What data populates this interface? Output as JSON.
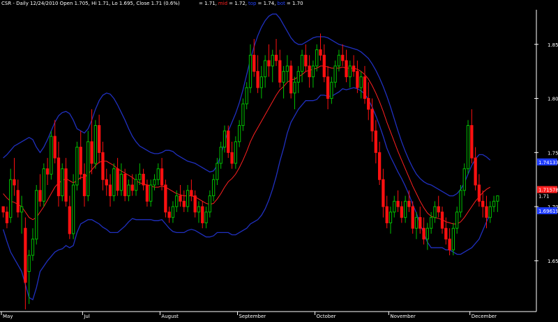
{
  "header": {
    "title": "CSR - Daily 12/24/2010 Open 1.705, Hi 1.71, Lo 1.695, Close 1.71 (0.6%)",
    "indicator_items": [
      {
        "text": "= 1.71,",
        "color": "#ffffff"
      },
      {
        "text": "mid",
        "color": "#ff2020"
      },
      {
        "text": "= 1.72,",
        "color": "#ffffff"
      },
      {
        "text": "top",
        "color": "#2040ff"
      },
      {
        "text": "= 1.74,",
        "color": "#ffffff"
      },
      {
        "text": "bot",
        "color": "#2040ff"
      },
      {
        "text": "= 1.70",
        "color": "#ffffff"
      }
    ]
  },
  "chart_data": {
    "type": "candlestick",
    "symbol": "CSR",
    "ylim": [
      1.603,
      1.882
    ],
    "y_ticks": [
      "1.850",
      "1.800",
      "1.750",
      "1.700",
      "1.650"
    ],
    "x_labels": [
      {
        "label": "May",
        "index": 0
      },
      {
        "label": "Jul",
        "index": 22
      },
      {
        "label": "August",
        "index": 43
      },
      {
        "label": "September",
        "index": 64
      },
      {
        "label": "October",
        "index": 85
      },
      {
        "label": "November",
        "index": 105
      },
      {
        "label": "December",
        "index": 127
      }
    ],
    "last_labels": [
      {
        "text": "1.74133",
        "value": 1.74133,
        "bg": "#1e3cff",
        "fg": "#ffffff"
      },
      {
        "text": "1.71578",
        "value": 1.71578,
        "bg": "#ff2020",
        "fg": "#ffffff"
      },
      {
        "text": "1.71",
        "value": 1.71,
        "bg": "",
        "fg": "#ffffff"
      },
      {
        "text": "1.69619",
        "value": 1.69619,
        "bg": "#1e3cff",
        "fg": "#ffffff"
      }
    ],
    "colors": {
      "up": "#00c000",
      "down": "#ff1010",
      "mid": "#ff2020",
      "band": "#2030c0",
      "grid": "#ffffff"
    },
    "ohlc": [
      [
        1.7,
        1.7,
        1.69,
        1.695
      ],
      [
        1.695,
        1.7,
        1.68,
        1.685
      ],
      [
        1.69,
        1.735,
        1.685,
        1.725
      ],
      [
        1.725,
        1.745,
        1.71,
        1.72
      ],
      [
        1.715,
        1.725,
        1.69,
        1.695
      ],
      [
        1.695,
        1.71,
        1.675,
        1.7
      ],
      [
        1.68,
        1.69,
        1.605,
        1.63
      ],
      [
        1.64,
        1.66,
        1.61,
        1.655
      ],
      [
        1.655,
        1.68,
        1.65,
        1.67
      ],
      [
        1.67,
        1.72,
        1.665,
        1.715
      ],
      [
        1.715,
        1.73,
        1.7,
        1.705
      ],
      [
        1.705,
        1.74,
        1.7,
        1.735
      ],
      [
        1.735,
        1.745,
        1.72,
        1.73
      ],
      [
        1.73,
        1.77,
        1.725,
        1.765
      ],
      [
        1.765,
        1.78,
        1.74,
        1.745
      ],
      [
        1.745,
        1.76,
        1.7,
        1.71
      ],
      [
        1.71,
        1.74,
        1.705,
        1.735
      ],
      [
        1.735,
        1.745,
        1.7,
        1.705
      ],
      [
        1.7,
        1.71,
        1.67,
        1.675
      ],
      [
        1.675,
        1.73,
        1.67,
        1.72
      ],
      [
        1.72,
        1.76,
        1.715,
        1.755
      ],
      [
        1.755,
        1.77,
        1.725,
        1.73
      ],
      [
        1.73,
        1.74,
        1.7,
        1.71
      ],
      [
        1.71,
        1.77,
        1.705,
        1.76
      ],
      [
        1.76,
        1.79,
        1.73,
        1.74
      ],
      [
        1.74,
        1.78,
        1.735,
        1.775
      ],
      [
        1.775,
        1.785,
        1.74,
        1.75
      ],
      [
        1.75,
        1.76,
        1.715,
        1.725
      ],
      [
        1.725,
        1.735,
        1.71,
        1.72
      ],
      [
        1.72,
        1.73,
        1.7,
        1.71
      ],
      [
        1.71,
        1.74,
        1.705,
        1.735
      ],
      [
        1.735,
        1.745,
        1.71,
        1.715
      ],
      [
        1.715,
        1.74,
        1.71,
        1.73
      ],
      [
        1.73,
        1.735,
        1.705,
        1.71
      ],
      [
        1.71,
        1.725,
        1.705,
        1.72
      ],
      [
        1.72,
        1.73,
        1.71,
        1.715
      ],
      [
        1.715,
        1.73,
        1.71,
        1.725
      ],
      [
        1.725,
        1.74,
        1.72,
        1.73
      ],
      [
        1.73,
        1.735,
        1.715,
        1.72
      ],
      [
        1.72,
        1.725,
        1.7,
        1.705
      ],
      [
        1.705,
        1.725,
        1.7,
        1.72
      ],
      [
        1.72,
        1.73,
        1.715,
        1.725
      ],
      [
        1.725,
        1.74,
        1.72,
        1.735
      ],
      [
        1.735,
        1.745,
        1.715,
        1.72
      ],
      [
        1.72,
        1.725,
        1.69,
        1.695
      ],
      [
        1.695,
        1.7,
        1.685,
        1.69
      ],
      [
        1.69,
        1.705,
        1.685,
        1.7
      ],
      [
        1.7,
        1.715,
        1.695,
        1.71
      ],
      [
        1.71,
        1.72,
        1.7,
        1.705
      ],
      [
        1.705,
        1.715,
        1.695,
        1.7
      ],
      [
        1.7,
        1.72,
        1.695,
        1.715
      ],
      [
        1.715,
        1.725,
        1.705,
        1.71
      ],
      [
        1.71,
        1.715,
        1.69,
        1.695
      ],
      [
        1.695,
        1.705,
        1.685,
        1.7
      ],
      [
        1.7,
        1.705,
        1.68,
        1.685
      ],
      [
        1.685,
        1.7,
        1.68,
        1.695
      ],
      [
        1.695,
        1.715,
        1.69,
        1.71
      ],
      [
        1.71,
        1.73,
        1.705,
        1.725
      ],
      [
        1.725,
        1.745,
        1.72,
        1.74
      ],
      [
        1.74,
        1.76,
        1.735,
        1.755
      ],
      [
        1.755,
        1.775,
        1.75,
        1.77
      ],
      [
        1.77,
        1.775,
        1.745,
        1.75
      ],
      [
        1.75,
        1.76,
        1.735,
        1.74
      ],
      [
        1.74,
        1.765,
        1.735,
        1.76
      ],
      [
        1.76,
        1.78,
        1.755,
        1.775
      ],
      [
        1.775,
        1.8,
        1.77,
        1.795
      ],
      [
        1.795,
        1.815,
        1.79,
        1.81
      ],
      [
        1.81,
        1.85,
        1.805,
        1.84
      ],
      [
        1.84,
        1.855,
        1.82,
        1.825
      ],
      [
        1.825,
        1.84,
        1.805,
        1.81
      ],
      [
        1.81,
        1.83,
        1.8,
        1.82
      ],
      [
        1.82,
        1.84,
        1.81,
        1.835
      ],
      [
        1.835,
        1.85,
        1.82,
        1.83
      ],
      [
        1.83,
        1.845,
        1.815,
        1.84
      ],
      [
        1.84,
        1.855,
        1.83,
        1.835
      ],
      [
        1.835,
        1.845,
        1.81,
        1.815
      ],
      [
        1.815,
        1.83,
        1.8,
        1.825
      ],
      [
        1.825,
        1.84,
        1.815,
        1.83
      ],
      [
        1.83,
        1.835,
        1.8,
        1.805
      ],
      [
        1.805,
        1.82,
        1.79,
        1.815
      ],
      [
        1.815,
        1.83,
        1.805,
        1.825
      ],
      [
        1.825,
        1.845,
        1.815,
        1.84
      ],
      [
        1.84,
        1.85,
        1.825,
        1.83
      ],
      [
        1.83,
        1.84,
        1.81,
        1.82
      ],
      [
        1.82,
        1.835,
        1.81,
        1.83
      ],
      [
        1.83,
        1.85,
        1.825,
        1.845
      ],
      [
        1.845,
        1.86,
        1.835,
        1.84
      ],
      [
        1.84,
        1.85,
        1.815,
        1.82
      ],
      [
        1.82,
        1.83,
        1.79,
        1.8
      ],
      [
        1.8,
        1.82,
        1.795,
        1.815
      ],
      [
        1.815,
        1.835,
        1.81,
        1.83
      ],
      [
        1.83,
        1.845,
        1.825,
        1.84
      ],
      [
        1.84,
        1.85,
        1.83,
        1.835
      ],
      [
        1.835,
        1.845,
        1.815,
        1.82
      ],
      [
        1.82,
        1.835,
        1.81,
        1.83
      ],
      [
        1.83,
        1.84,
        1.82,
        1.825
      ],
      [
        1.825,
        1.835,
        1.805,
        1.81
      ],
      [
        1.81,
        1.825,
        1.8,
        1.82
      ],
      [
        1.82,
        1.83,
        1.795,
        1.8
      ],
      [
        1.8,
        1.815,
        1.78,
        1.79
      ],
      [
        1.79,
        1.8,
        1.76,
        1.77
      ],
      [
        1.77,
        1.78,
        1.74,
        1.75
      ],
      [
        1.75,
        1.76,
        1.72,
        1.725
      ],
      [
        1.725,
        1.735,
        1.69,
        1.7
      ],
      [
        1.7,
        1.71,
        1.68,
        1.685
      ],
      [
        1.685,
        1.7,
        1.675,
        1.695
      ],
      [
        1.695,
        1.71,
        1.69,
        1.705
      ],
      [
        1.705,
        1.715,
        1.695,
        1.7
      ],
      [
        1.7,
        1.705,
        1.685,
        1.69
      ],
      [
        1.69,
        1.71,
        1.685,
        1.705
      ],
      [
        1.705,
        1.715,
        1.695,
        1.7
      ],
      [
        1.7,
        1.705,
        1.675,
        1.68
      ],
      [
        1.68,
        1.695,
        1.67,
        1.69
      ],
      [
        1.69,
        1.7,
        1.675,
        1.68
      ],
      [
        1.68,
        1.69,
        1.665,
        1.67
      ],
      [
        1.67,
        1.685,
        1.66,
        1.68
      ],
      [
        1.68,
        1.695,
        1.675,
        1.69
      ],
      [
        1.69,
        1.705,
        1.685,
        1.7
      ],
      [
        1.7,
        1.71,
        1.69,
        1.695
      ],
      [
        1.695,
        1.7,
        1.675,
        1.68
      ],
      [
        1.68,
        1.69,
        1.665,
        1.67
      ],
      [
        1.67,
        1.68,
        1.655,
        1.66
      ],
      [
        1.66,
        1.685,
        1.655,
        1.68
      ],
      [
        1.68,
        1.7,
        1.675,
        1.695
      ],
      [
        1.695,
        1.72,
        1.69,
        1.715
      ],
      [
        1.715,
        1.74,
        1.71,
        1.735
      ],
      [
        1.735,
        1.78,
        1.73,
        1.775
      ],
      [
        1.775,
        1.79,
        1.74,
        1.745
      ],
      [
        1.745,
        1.755,
        1.715,
        1.72
      ],
      [
        1.72,
        1.73,
        1.7,
        1.705
      ],
      [
        1.705,
        1.715,
        1.69,
        1.7
      ],
      [
        1.7,
        1.71,
        1.68,
        1.69
      ],
      [
        1.69,
        1.705,
        1.685,
        1.7
      ],
      [
        1.7,
        1.71,
        1.695,
        1.705
      ],
      [
        1.705,
        1.71,
        1.695,
        1.71
      ]
    ],
    "mid": [
      1.712,
      1.708,
      1.705,
      1.704,
      1.702,
      1.7,
      1.695,
      1.69,
      1.688,
      1.69,
      1.695,
      1.7,
      1.706,
      1.712,
      1.718,
      1.722,
      1.724,
      1.726,
      1.724,
      1.722,
      1.724,
      1.727,
      1.727,
      1.73,
      1.734,
      1.738,
      1.741,
      1.742,
      1.742,
      1.74,
      1.738,
      1.735,
      1.733,
      1.731,
      1.729,
      1.727,
      1.724,
      1.722,
      1.721,
      1.72,
      1.719,
      1.718,
      1.718,
      1.719,
      1.718,
      1.716,
      1.714,
      1.712,
      1.711,
      1.71,
      1.71,
      1.71,
      1.709,
      1.707,
      1.705,
      1.703,
      1.702,
      1.703,
      1.707,
      1.712,
      1.718,
      1.723,
      1.726,
      1.73,
      1.736,
      1.743,
      1.751,
      1.76,
      1.767,
      1.773,
      1.779,
      1.785,
      1.791,
      1.797,
      1.803,
      1.808,
      1.811,
      1.815,
      1.817,
      1.818,
      1.82,
      1.822,
      1.825,
      1.826,
      1.827,
      1.828,
      1.83,
      1.83,
      1.829,
      1.828,
      1.828,
      1.828,
      1.829,
      1.828,
      1.828,
      1.828,
      1.827,
      1.825,
      1.822,
      1.818,
      1.812,
      1.805,
      1.797,
      1.788,
      1.778,
      1.769,
      1.76,
      1.751,
      1.743,
      1.735,
      1.727,
      1.719,
      1.712,
      1.705,
      1.699,
      1.694,
      1.691,
      1.69,
      1.689,
      1.688,
      1.686,
      1.685,
      1.684,
      1.684,
      1.686,
      1.69,
      1.695,
      1.7,
      1.705,
      1.709,
      1.713,
      1.716,
      1.718
    ],
    "top": [
      1.745,
      1.748,
      1.752,
      1.756,
      1.758,
      1.76,
      1.762,
      1.764,
      1.762,
      1.755,
      1.75,
      1.755,
      1.762,
      1.77,
      1.778,
      1.784,
      1.787,
      1.788,
      1.786,
      1.78,
      1.772,
      1.77,
      1.768,
      1.772,
      1.78,
      1.79,
      1.798,
      1.803,
      1.805,
      1.804,
      1.8,
      1.794,
      1.787,
      1.78,
      1.772,
      1.765,
      1.76,
      1.756,
      1.754,
      1.752,
      1.75,
      1.749,
      1.749,
      1.75,
      1.752,
      1.752,
      1.751,
      1.748,
      1.746,
      1.744,
      1.742,
      1.741,
      1.74,
      1.738,
      1.736,
      1.734,
      1.732,
      1.733,
      1.738,
      1.748,
      1.76,
      1.77,
      1.778,
      1.786,
      1.796,
      1.808,
      1.822,
      1.836,
      1.848,
      1.858,
      1.866,
      1.872,
      1.876,
      1.878,
      1.878,
      1.874,
      1.868,
      1.862,
      1.856,
      1.852,
      1.85,
      1.85,
      1.852,
      1.854,
      1.856,
      1.857,
      1.857,
      1.857,
      1.856,
      1.854,
      1.852,
      1.85,
      1.849,
      1.848,
      1.847,
      1.846,
      1.845,
      1.843,
      1.84,
      1.837,
      1.832,
      1.826,
      1.819,
      1.811,
      1.802,
      1.792,
      1.781,
      1.77,
      1.76,
      1.751,
      1.743,
      1.736,
      1.73,
      1.726,
      1.723,
      1.721,
      1.72,
      1.718,
      1.716,
      1.714,
      1.712,
      1.71,
      1.71,
      1.712,
      1.716,
      1.722,
      1.73,
      1.738,
      1.744,
      1.748,
      1.748,
      1.746,
      1.743
    ]
  }
}
